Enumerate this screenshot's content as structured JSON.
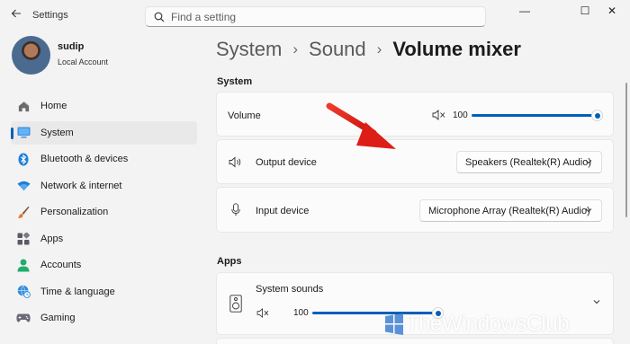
{
  "app": {
    "title": "Settings"
  },
  "search": {
    "placeholder": "Find a setting"
  },
  "window_controls": {
    "minimize": "—",
    "maximize": "☐",
    "close": "✕"
  },
  "user": {
    "name": "sudip",
    "account_type": "Local Account"
  },
  "nav": [
    {
      "label": "Home",
      "icon": "home-icon"
    },
    {
      "label": "System",
      "icon": "system-icon",
      "active": true
    },
    {
      "label": "Bluetooth & devices",
      "icon": "bluetooth-icon"
    },
    {
      "label": "Network & internet",
      "icon": "wifi-icon"
    },
    {
      "label": "Personalization",
      "icon": "brush-icon"
    },
    {
      "label": "Apps",
      "icon": "apps-icon"
    },
    {
      "label": "Accounts",
      "icon": "person-icon"
    },
    {
      "label": "Time & language",
      "icon": "globe-clock-icon"
    },
    {
      "label": "Gaming",
      "icon": "controller-icon"
    }
  ],
  "breadcrumb": {
    "level1": "System",
    "level2": "Sound",
    "current": "Volume mixer",
    "separator": "›"
  },
  "system_section": {
    "title": "System",
    "volume": {
      "label": "Volume",
      "value": "100",
      "level": 1.0
    },
    "output_device": {
      "label": "Output device",
      "selected": "Speakers (Realtek(R) Audio)"
    },
    "input_device": {
      "label": "Input device",
      "selected": "Microphone Array (Realtek(R) Audio)"
    }
  },
  "apps_section": {
    "title": "Apps",
    "system_sounds": {
      "label": "System sounds",
      "value": "100",
      "level": 1.0
    }
  },
  "watermark": {
    "text": "TheWindowsClub"
  },
  "colors": {
    "accent": "#005fb8",
    "annotation_arrow": "#e8201a"
  }
}
